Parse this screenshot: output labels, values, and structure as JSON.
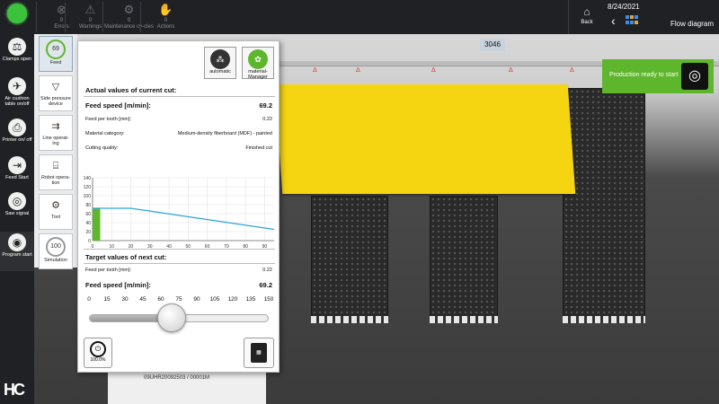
{
  "topbar": {
    "stats": [
      {
        "icon": "circle-x-icon",
        "glyph": "⊗",
        "count": "0",
        "label": "Errors"
      },
      {
        "icon": "warning-icon",
        "glyph": "⚠",
        "count": "0",
        "label": "Warnings"
      },
      {
        "icon": "wrench-icon",
        "glyph": "⚙",
        "count": "0",
        "label": "Maintenance cy-cles"
      },
      {
        "icon": "hand-icon",
        "glyph": "✋",
        "count": "0",
        "label": "Actions"
      }
    ],
    "back_label": "Back",
    "date": "8/24/2021",
    "view_title": "Flow diagram"
  },
  "sidebar": {
    "items": [
      {
        "name": "clamps-open",
        "label": "Clamps open",
        "glyph": "⚖"
      },
      {
        "name": "air-cushion",
        "label": "Air cushion table on/off",
        "glyph": "✈"
      },
      {
        "name": "printer",
        "label": "Printer on/ off",
        "glyph": "⎙"
      },
      {
        "name": "feed-start",
        "label": "Feed Start",
        "glyph": "⇥"
      },
      {
        "name": "saw-signal",
        "label": "Saw signal",
        "glyph": "◎"
      },
      {
        "name": "program-start",
        "label": "Program start",
        "glyph": "◉"
      }
    ],
    "logo": "HC"
  },
  "submenu": {
    "items": [
      {
        "name": "feed",
        "label": "Feed",
        "value": "69"
      },
      {
        "name": "side-pressure",
        "label": "Side pressure device",
        "glyph": "▽"
      },
      {
        "name": "line-operating",
        "label": "Line operat-ing",
        "glyph": "⇉"
      },
      {
        "name": "robot-operation",
        "label": "Robot opera-tion",
        "glyph": "⌸"
      },
      {
        "name": "tool",
        "label": "Tool",
        "glyph": "⚙"
      },
      {
        "name": "simulation",
        "label": "Simulation",
        "value": "100"
      }
    ]
  },
  "scene": {
    "panel_id": "3046",
    "production_status": "Production ready to start",
    "order_number": "09UHR20092503 / 00001M"
  },
  "panel": {
    "mode_auto_label": "automatic",
    "mode_material_label": "material-Manager",
    "current_title": "Actual values of current cut:",
    "feed_speed_label": "Feed speed [m/min]:",
    "feed_speed_value": "69.2",
    "feed_per_tooth_label": "Feed per tooth [mm]:",
    "feed_per_tooth_value": "0.22",
    "material_label": "Material category:",
    "material_value": "Medium-density fiberboard (MDF) - painted",
    "quality_label": "Cutting quality:",
    "quality_value": "Finished cut",
    "next_title": "Target values of next cut:",
    "next_feed_per_tooth_label": "Feed per tooth [mm]:",
    "next_feed_per_tooth_value": "0.22",
    "next_feed_speed_label": "Feed speed [m/min]:",
    "next_feed_speed_value": "69.2",
    "slider_scale": [
      "0",
      "15",
      "30",
      "45",
      "60",
      "75",
      "90",
      "105",
      "120",
      "135",
      "150"
    ],
    "slider_value": 69.2,
    "slider_max": 150,
    "speed_override": "100.0%"
  },
  "chart_data": {
    "type": "line",
    "x": [
      0,
      20,
      95
    ],
    "y": [
      72,
      72,
      25
    ],
    "xlim": [
      0,
      95
    ],
    "ylim": [
      0,
      140
    ],
    "xticks": [
      0,
      10,
      20,
      30,
      40,
      50,
      60,
      70,
      80,
      90
    ],
    "yticks": [
      0,
      20,
      40,
      60,
      80,
      100,
      120,
      140
    ],
    "highlight_bar": {
      "x0": 0,
      "x1": 4,
      "value": 72
    },
    "line_color": "#2aa5d8",
    "bar_color": "#5eb62d",
    "grid": true
  }
}
